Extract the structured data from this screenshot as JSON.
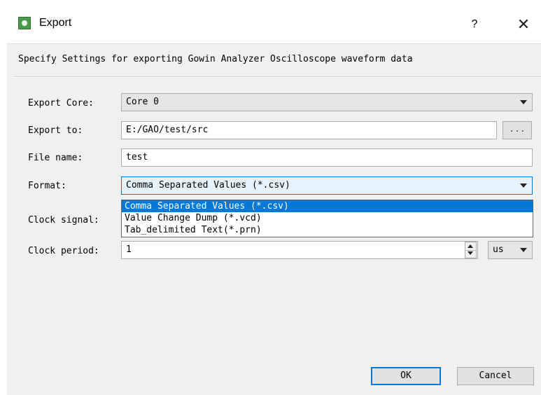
{
  "window": {
    "title": "Export",
    "help_label": "?",
    "close_label": "✕",
    "icon": "gowin-app-icon"
  },
  "header_text": "Specify Settings for exporting Gowin Analyzer Oscilloscope waveform data",
  "form": {
    "export_core": {
      "label": "Export Core:",
      "value": "Core 0"
    },
    "export_to": {
      "label": "Export to:",
      "value": "E:/GAO/test/src",
      "browse_label": "..."
    },
    "file_name": {
      "label": "File name:",
      "value": "test"
    },
    "format": {
      "label": "Format:",
      "value": "Comma Separated Values (*.csv)",
      "options": [
        "Comma Separated Values (*.csv)",
        "Value Change Dump (*.vcd)",
        "Tab_delimited Text(*.prn)"
      ],
      "selected_index": 0
    },
    "clock_signal": {
      "label": "Clock signal:"
    },
    "clock_period": {
      "label": "Clock period:",
      "value": "1",
      "unit": "us"
    }
  },
  "buttons": {
    "ok": "OK",
    "cancel": "Cancel"
  },
  "colors": {
    "selection": "#0078d7",
    "background": "#f0f0f0"
  }
}
